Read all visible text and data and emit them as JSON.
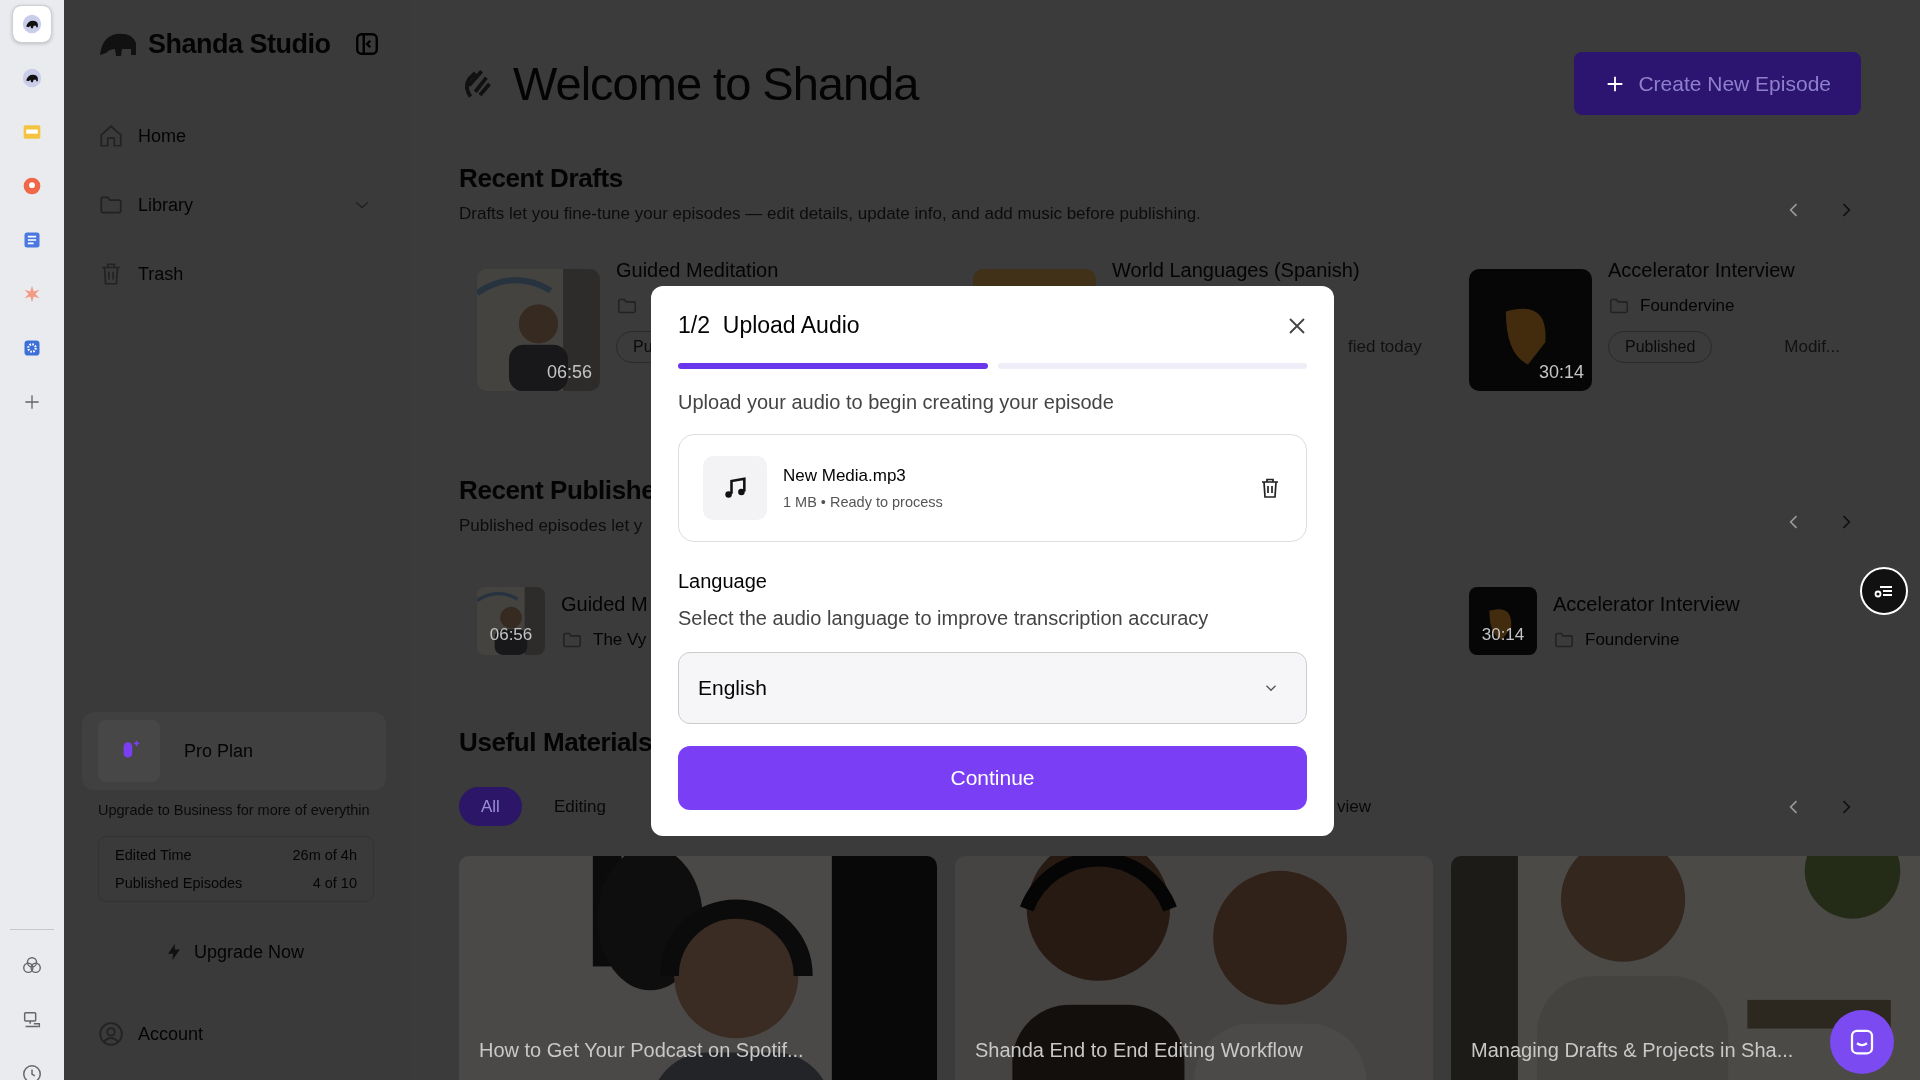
{
  "rail": {
    "items": [
      {
        "selected": true
      },
      {
        "selected": false
      },
      {
        "selected": false
      },
      {
        "selected": false
      },
      {
        "selected": false
      },
      {
        "selected": false
      },
      {
        "selected": false
      }
    ]
  },
  "sidebar": {
    "brand": "Shanda Studio",
    "nav": [
      {
        "kind": "home",
        "label": "Home",
        "has_submenu": false
      },
      {
        "kind": "library",
        "label": "Library",
        "has_submenu": true
      },
      {
        "kind": "trash",
        "label": "Trash",
        "has_submenu": false
      }
    ],
    "plan": {
      "name": "Pro Plan",
      "note": "Upgrade to Business for more of everythin",
      "stats": [
        {
          "label": "Edited Time",
          "value": "26m of 4h"
        },
        {
          "label": "Published Episodes",
          "value": "4 of 10"
        }
      ],
      "upgrade": "Upgrade Now"
    },
    "account": "Account"
  },
  "main": {
    "title": "Welcome to Shanda",
    "create_button": "Create New Episode",
    "drafts": {
      "title": "Recent Drafts",
      "subtitle": "Drafts let you fine-tune your episodes — edit details, update info, and add music before publishing.",
      "cards": [
        {
          "title": "Guided Meditation",
          "duration": "06:56",
          "status": "Pu"
        },
        {
          "title": "World Languages (Spanish)",
          "modified": "fied today"
        },
        {
          "title": "Accelerator Interview",
          "duration": "30:14",
          "folder": "Foundervine",
          "status": "Published",
          "modified": "Modif..."
        }
      ]
    },
    "published": {
      "title": "Recent Publishe",
      "subtitle": "Published episodes let y",
      "cards": [
        {
          "title": "Guided M",
          "duration": "06:56",
          "folder": "The Vy"
        },
        {
          "title": "Accelerator Interview",
          "duration": "30:14",
          "folder": "Foundervine"
        }
      ]
    },
    "materials": {
      "title": "Useful Materials",
      "chips": [
        {
          "label": "All",
          "selected": true
        },
        {
          "label": "Editing",
          "selected": false
        },
        {
          "label": "view",
          "selected": false
        }
      ],
      "videos": [
        {
          "title": "How to Get Your Podcast on Spotif..."
        },
        {
          "title": "Shanda End to End Editing Workflow"
        },
        {
          "title": "Managing Drafts & Projects in Sha..."
        }
      ]
    }
  },
  "dialog": {
    "step": "1/2",
    "title": "Upload Audio",
    "steps": [
      {
        "complete": true
      },
      {
        "complete": false
      }
    ],
    "subtitle": "Upload your audio to begin creating your episode",
    "file": {
      "name": "New Media.mp3",
      "meta": "1 MB • Ready to process"
    },
    "language_label": "Language",
    "language_hint": "Select the audio language to improve transcription accuracy",
    "language": "English",
    "button": "Continue"
  }
}
